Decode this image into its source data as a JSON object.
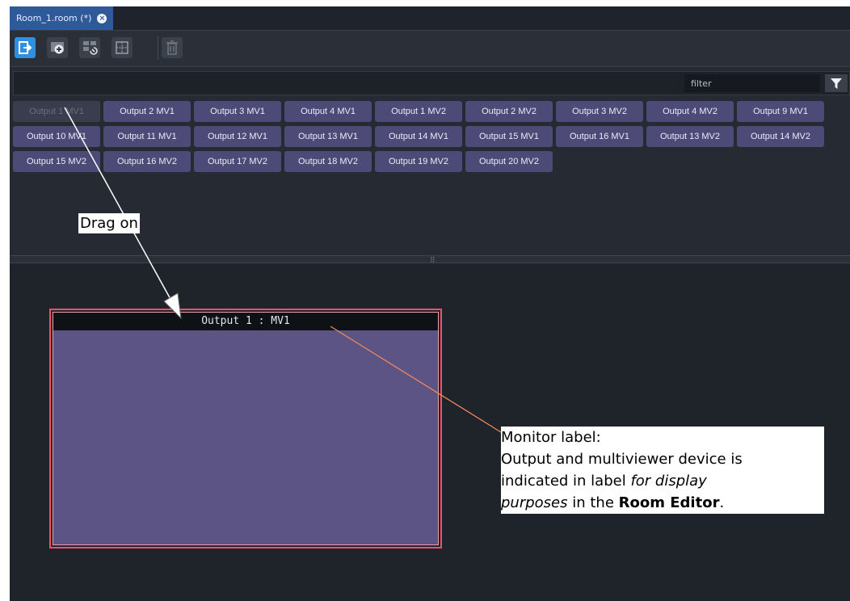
{
  "tab": {
    "title": "Room_1.room (*)",
    "close_glyph": "×"
  },
  "toolbar": {
    "buttons": [
      {
        "name": "exit-editor-icon",
        "active": true
      },
      {
        "name": "add-monitor-icon",
        "active": false
      },
      {
        "name": "link-layout-icon",
        "active": false
      },
      {
        "name": "grid-icon",
        "active": false
      },
      {
        "name": "delete-icon",
        "active": false
      }
    ]
  },
  "filter": {
    "placeholder": "filter"
  },
  "outputs": [
    {
      "label": "Output 1 MV1",
      "used": true
    },
    {
      "label": "Output 2 MV1"
    },
    {
      "label": "Output 3 MV1"
    },
    {
      "label": "Output 4 MV1"
    },
    {
      "label": "Output 1 MV2"
    },
    {
      "label": "Output 2 MV2"
    },
    {
      "label": "Output 3 MV2"
    },
    {
      "label": "Output 4 MV2"
    },
    {
      "label": "Output 9 MV1"
    },
    {
      "label": "Output 10 MV1"
    },
    {
      "label": "Output 11 MV1"
    },
    {
      "label": "Output 12 MV1"
    },
    {
      "label": "Output 13 MV1"
    },
    {
      "label": "Output 14 MV1"
    },
    {
      "label": "Output 15 MV1"
    },
    {
      "label": "Output 16 MV1"
    },
    {
      "label": "Output 13 MV2"
    },
    {
      "label": "Output 14 MV2"
    },
    {
      "label": "Output 15 MV2"
    },
    {
      "label": "Output 16 MV2"
    },
    {
      "label": "Output 17 MV2"
    },
    {
      "label": "Output 18 MV2"
    },
    {
      "label": "Output 19 MV2"
    },
    {
      "label": "Output 20 MV2"
    }
  ],
  "monitor": {
    "label": "Output 1 : MV1"
  },
  "annotations": {
    "drag": "Drag on",
    "monitor_note": {
      "title": "Monitor label:",
      "line2": "Output and multiviewer device is",
      "line3_pre": "indicated in label ",
      "line3_em": "for display",
      "line4_em": "purposes",
      "line4_mid": " in the ",
      "line4_strong": "Room Editor",
      "line4_end": "."
    }
  },
  "colors": {
    "accent": "#2f8fe0",
    "chip": "#4d4a78",
    "monitor_fill": "#5b5484",
    "monitor_border": "#f05068",
    "callout_line": "#f08a5a"
  }
}
